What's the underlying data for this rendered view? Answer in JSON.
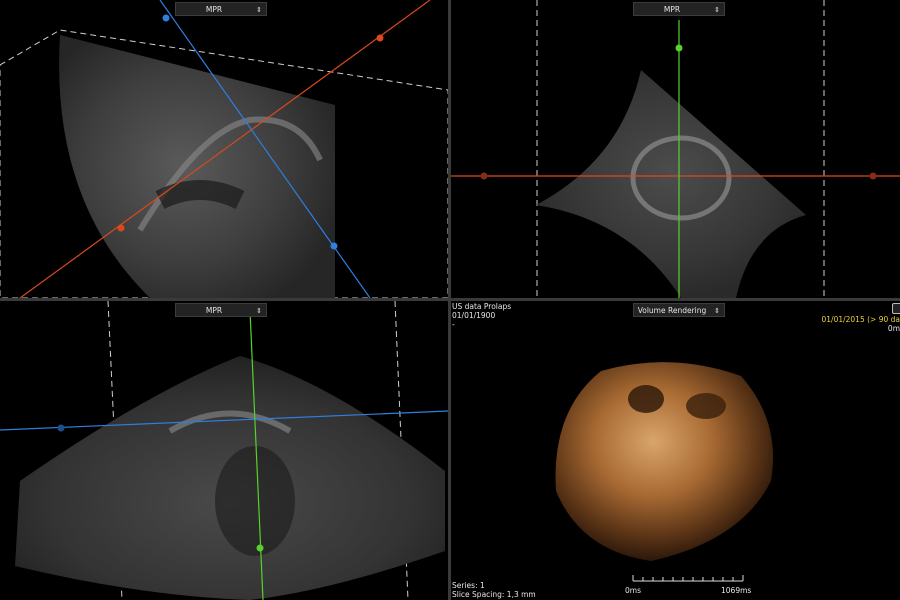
{
  "viewports": {
    "top_left": {
      "mode": "MPR"
    },
    "top_right": {
      "mode": "MPR"
    },
    "bottom_left": {
      "mode": "MPR"
    },
    "bottom_right": {
      "mode": "Volume Rendering"
    }
  },
  "patient_info": {
    "study": "US data Prolaps",
    "date": "01/01/1900",
    "extra": "-"
  },
  "study_date_badge": "01/01/2015 (> 90 da",
  "corner_value": "0m",
  "series_info": {
    "series": "Series: 1",
    "slice_spacing": "Slice Spacing: 1,3 mm"
  },
  "timeline": {
    "start_label": "0ms",
    "end_label": "1069ms"
  },
  "icons": {
    "dropdown": "caret-down-icon",
    "tool": "tool-icon"
  },
  "colors": {
    "red_axis": "#d9491c",
    "blue_axis": "#2f7fe0",
    "green_axis": "#56d12e",
    "dashed_frame": "#d0d0d0",
    "date_yellow": "#e8d23a"
  }
}
